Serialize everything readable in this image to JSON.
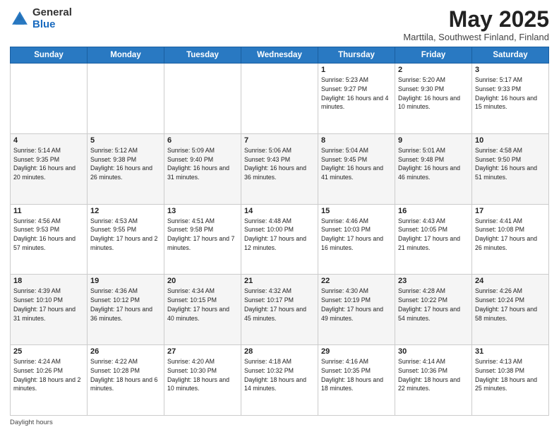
{
  "header": {
    "logo_general": "General",
    "logo_blue": "Blue",
    "month_year": "May 2025",
    "location": "Marttila, Southwest Finland, Finland"
  },
  "days_of_week": [
    "Sunday",
    "Monday",
    "Tuesday",
    "Wednesday",
    "Thursday",
    "Friday",
    "Saturday"
  ],
  "footer": {
    "daylight_hours": "Daylight hours"
  },
  "weeks": [
    [
      {
        "day": "",
        "info": ""
      },
      {
        "day": "",
        "info": ""
      },
      {
        "day": "",
        "info": ""
      },
      {
        "day": "",
        "info": ""
      },
      {
        "day": "1",
        "info": "Sunrise: 5:23 AM\nSunset: 9:27 PM\nDaylight: 16 hours and 4 minutes."
      },
      {
        "day": "2",
        "info": "Sunrise: 5:20 AM\nSunset: 9:30 PM\nDaylight: 16 hours and 10 minutes."
      },
      {
        "day": "3",
        "info": "Sunrise: 5:17 AM\nSunset: 9:33 PM\nDaylight: 16 hours and 15 minutes."
      }
    ],
    [
      {
        "day": "4",
        "info": "Sunrise: 5:14 AM\nSunset: 9:35 PM\nDaylight: 16 hours and 20 minutes."
      },
      {
        "day": "5",
        "info": "Sunrise: 5:12 AM\nSunset: 9:38 PM\nDaylight: 16 hours and 26 minutes."
      },
      {
        "day": "6",
        "info": "Sunrise: 5:09 AM\nSunset: 9:40 PM\nDaylight: 16 hours and 31 minutes."
      },
      {
        "day": "7",
        "info": "Sunrise: 5:06 AM\nSunset: 9:43 PM\nDaylight: 16 hours and 36 minutes."
      },
      {
        "day": "8",
        "info": "Sunrise: 5:04 AM\nSunset: 9:45 PM\nDaylight: 16 hours and 41 minutes."
      },
      {
        "day": "9",
        "info": "Sunrise: 5:01 AM\nSunset: 9:48 PM\nDaylight: 16 hours and 46 minutes."
      },
      {
        "day": "10",
        "info": "Sunrise: 4:58 AM\nSunset: 9:50 PM\nDaylight: 16 hours and 51 minutes."
      }
    ],
    [
      {
        "day": "11",
        "info": "Sunrise: 4:56 AM\nSunset: 9:53 PM\nDaylight: 16 hours and 57 minutes."
      },
      {
        "day": "12",
        "info": "Sunrise: 4:53 AM\nSunset: 9:55 PM\nDaylight: 17 hours and 2 minutes."
      },
      {
        "day": "13",
        "info": "Sunrise: 4:51 AM\nSunset: 9:58 PM\nDaylight: 17 hours and 7 minutes."
      },
      {
        "day": "14",
        "info": "Sunrise: 4:48 AM\nSunset: 10:00 PM\nDaylight: 17 hours and 12 minutes."
      },
      {
        "day": "15",
        "info": "Sunrise: 4:46 AM\nSunset: 10:03 PM\nDaylight: 17 hours and 16 minutes."
      },
      {
        "day": "16",
        "info": "Sunrise: 4:43 AM\nSunset: 10:05 PM\nDaylight: 17 hours and 21 minutes."
      },
      {
        "day": "17",
        "info": "Sunrise: 4:41 AM\nSunset: 10:08 PM\nDaylight: 17 hours and 26 minutes."
      }
    ],
    [
      {
        "day": "18",
        "info": "Sunrise: 4:39 AM\nSunset: 10:10 PM\nDaylight: 17 hours and 31 minutes."
      },
      {
        "day": "19",
        "info": "Sunrise: 4:36 AM\nSunset: 10:12 PM\nDaylight: 17 hours and 36 minutes."
      },
      {
        "day": "20",
        "info": "Sunrise: 4:34 AM\nSunset: 10:15 PM\nDaylight: 17 hours and 40 minutes."
      },
      {
        "day": "21",
        "info": "Sunrise: 4:32 AM\nSunset: 10:17 PM\nDaylight: 17 hours and 45 minutes."
      },
      {
        "day": "22",
        "info": "Sunrise: 4:30 AM\nSunset: 10:19 PM\nDaylight: 17 hours and 49 minutes."
      },
      {
        "day": "23",
        "info": "Sunrise: 4:28 AM\nSunset: 10:22 PM\nDaylight: 17 hours and 54 minutes."
      },
      {
        "day": "24",
        "info": "Sunrise: 4:26 AM\nSunset: 10:24 PM\nDaylight: 17 hours and 58 minutes."
      }
    ],
    [
      {
        "day": "25",
        "info": "Sunrise: 4:24 AM\nSunset: 10:26 PM\nDaylight: 18 hours and 2 minutes."
      },
      {
        "day": "26",
        "info": "Sunrise: 4:22 AM\nSunset: 10:28 PM\nDaylight: 18 hours and 6 minutes."
      },
      {
        "day": "27",
        "info": "Sunrise: 4:20 AM\nSunset: 10:30 PM\nDaylight: 18 hours and 10 minutes."
      },
      {
        "day": "28",
        "info": "Sunrise: 4:18 AM\nSunset: 10:32 PM\nDaylight: 18 hours and 14 minutes."
      },
      {
        "day": "29",
        "info": "Sunrise: 4:16 AM\nSunset: 10:35 PM\nDaylight: 18 hours and 18 minutes."
      },
      {
        "day": "30",
        "info": "Sunrise: 4:14 AM\nSunset: 10:36 PM\nDaylight: 18 hours and 22 minutes."
      },
      {
        "day": "31",
        "info": "Sunrise: 4:13 AM\nSunset: 10:38 PM\nDaylight: 18 hours and 25 minutes."
      }
    ]
  ]
}
